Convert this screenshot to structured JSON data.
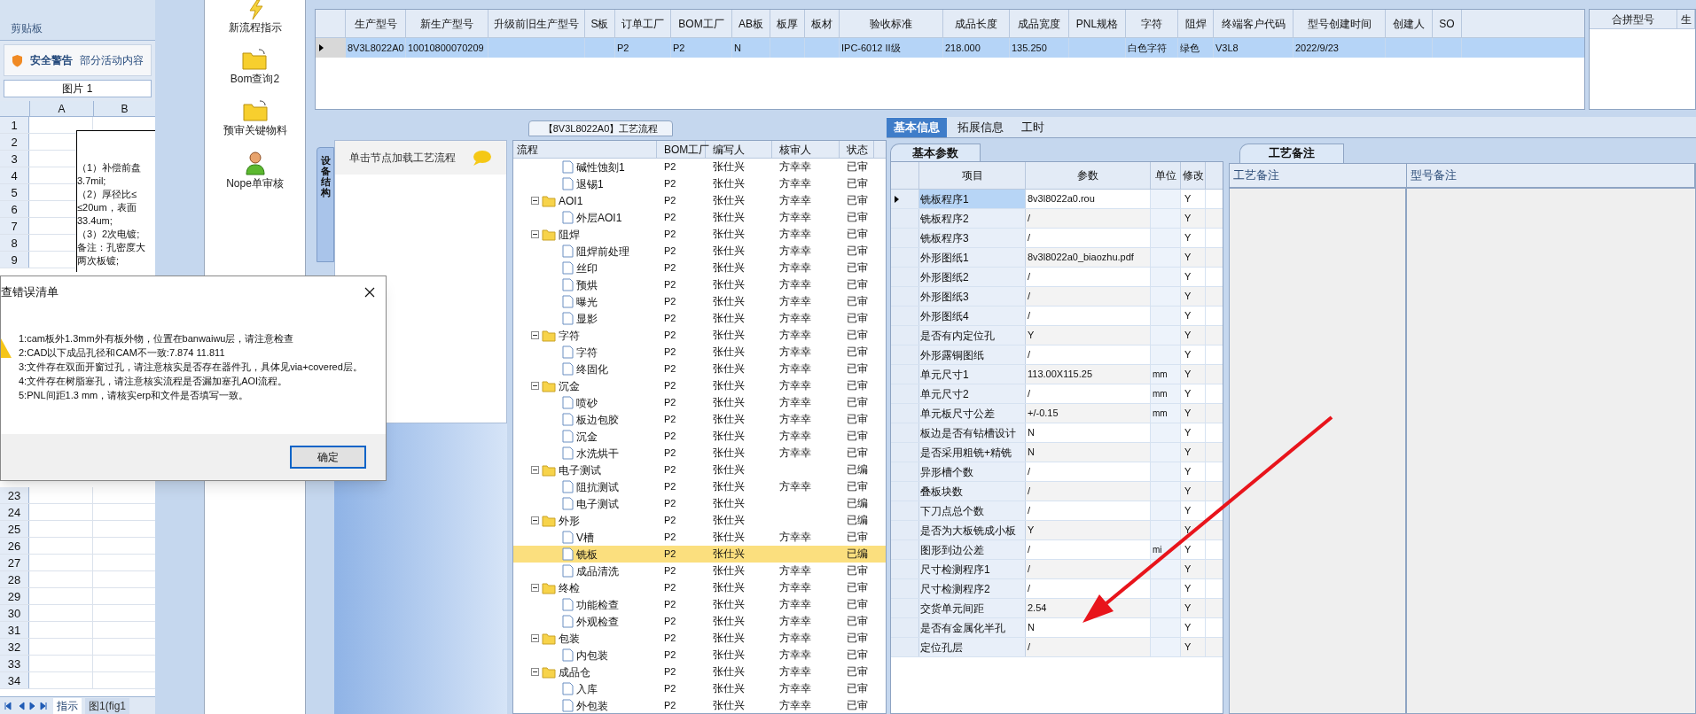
{
  "excel": {
    "ribbon_group": "剪贴板",
    "security_warning": {
      "title": "安全警告",
      "message": "部分活动内容"
    },
    "name_box": "图片 1",
    "columns": [
      "A",
      "B"
    ],
    "rows": [
      "1",
      "2",
      "3",
      "4",
      "5",
      "6",
      "7",
      "8",
      "9",
      "23",
      "24",
      "25",
      "26",
      "27",
      "28",
      "29",
      "30",
      "31",
      "32",
      "33",
      "34"
    ],
    "cell_lines": [
      "（1）补偿前盘",
      "3.7mil;",
      "（2）厚径比≤",
      "≤20um，表面",
      "33.4um;",
      "（3）2次电镀;",
      "备注：孔密度大",
      "两次板镀;"
    ],
    "sheet_tabs": [
      {
        "label": "指示",
        "selected": true
      },
      {
        "label": "图1(fig1",
        "selected": false
      }
    ]
  },
  "toolbar": [
    {
      "label": "新流程指示",
      "kind": "lightning"
    },
    {
      "label": "Bom查询2",
      "kind": "folder"
    },
    {
      "label": "预审关键物料",
      "kind": "folder"
    },
    {
      "label": "Nope单审核",
      "kind": "person"
    }
  ],
  "product_table": {
    "columns": [
      "生产型号",
      "新生产型号",
      "升级前旧生产型号",
      "S板",
      "订单工厂",
      "BOM工厂",
      "AB板",
      "板厚",
      "板材",
      "验收标准",
      "成品长度",
      "成品宽度",
      "PNL规格",
      "字符",
      "阻焊",
      "终端客户代码",
      "型号创建时间",
      "创建人",
      "SO"
    ],
    "rows": [
      {
        "selected": true,
        "cells": [
          "8V3L8022A0",
          "10010800070209",
          null,
          null,
          "P2",
          "P2",
          "N",
          null,
          null,
          "IPC-6012 II级",
          "218.000",
          "135.250",
          null,
          "白色字符",
          "绿色",
          "V3L8",
          "2022/9/23",
          null,
          null
        ]
      }
    ]
  },
  "merge_panel": {
    "columns": [
      "合拼型号",
      "生"
    ]
  },
  "process": {
    "title": "【8V3L8022A0】工艺流程",
    "side_tab": "设备结构",
    "hint": "单击节点加载工艺流程",
    "columns": [
      "流程",
      "BOM工厂",
      "编写人",
      "核审人",
      "状态"
    ],
    "rows": [
      {
        "kind": "file",
        "name": "碱性蚀刻1",
        "bom": "P2",
        "writer": "张仕兴",
        "reviewer": "方幸幸",
        "status": "已审",
        "selected": false
      },
      {
        "kind": "file",
        "name": "退锡1",
        "bom": "P2",
        "writer": "张仕兴",
        "reviewer": "方幸幸",
        "status": "已审",
        "selected": false
      },
      {
        "kind": "folder",
        "name": "AOI1",
        "bom": "P2",
        "writer": "张仕兴",
        "reviewer": "方幸幸",
        "status": "已审",
        "selected": false,
        "children": [
          {
            "kind": "file",
            "name": "外层AOI1",
            "bom": "P2",
            "writer": "张仕兴",
            "reviewer": "方幸幸",
            "status": "已审",
            "selected": false
          }
        ]
      },
      {
        "kind": "folder",
        "name": "阻焊",
        "bom": "P2",
        "writer": "张仕兴",
        "reviewer": "方幸幸",
        "status": "已审",
        "selected": false,
        "children": [
          {
            "kind": "file",
            "name": "阻焊前处理",
            "bom": "P2",
            "writer": "张仕兴",
            "reviewer": "方幸幸",
            "status": "已审",
            "selected": false
          },
          {
            "kind": "file",
            "name": "丝印",
            "bom": "P2",
            "writer": "张仕兴",
            "reviewer": "方幸幸",
            "status": "已审",
            "selected": false
          },
          {
            "kind": "file",
            "name": "预烘",
            "bom": "P2",
            "writer": "张仕兴",
            "reviewer": "方幸幸",
            "status": "已审",
            "selected": false
          },
          {
            "kind": "file",
            "name": "曝光",
            "bom": "P2",
            "writer": "张仕兴",
            "reviewer": "方幸幸",
            "status": "已审",
            "selected": false
          },
          {
            "kind": "file",
            "name": "显影",
            "bom": "P2",
            "writer": "张仕兴",
            "reviewer": "方幸幸",
            "status": "已审",
            "selected": false
          }
        ]
      },
      {
        "kind": "folder",
        "name": "字符",
        "bom": "P2",
        "writer": "张仕兴",
        "reviewer": "方幸幸",
        "status": "已审",
        "selected": false,
        "children": [
          {
            "kind": "file",
            "name": "字符",
            "bom": "P2",
            "writer": "张仕兴",
            "reviewer": "方幸幸",
            "status": "已审",
            "selected": false
          },
          {
            "kind": "file",
            "name": "终固化",
            "bom": "P2",
            "writer": "张仕兴",
            "reviewer": "方幸幸",
            "status": "已审",
            "selected": false
          }
        ]
      },
      {
        "kind": "folder",
        "name": "沉金",
        "bom": "P2",
        "writer": "张仕兴",
        "reviewer": "方幸幸",
        "status": "已审",
        "selected": false,
        "children": [
          {
            "kind": "file",
            "name": "喷砂",
            "bom": "P2",
            "writer": "张仕兴",
            "reviewer": "方幸幸",
            "status": "已审",
            "selected": false
          },
          {
            "kind": "file",
            "name": "板边包胶",
            "bom": "P2",
            "writer": "张仕兴",
            "reviewer": "方幸幸",
            "status": "已审",
            "selected": false
          },
          {
            "kind": "file",
            "name": "沉金",
            "bom": "P2",
            "writer": "张仕兴",
            "reviewer": "方幸幸",
            "status": "已审",
            "selected": false
          },
          {
            "kind": "file",
            "name": "水洗烘干",
            "bom": "P2",
            "writer": "张仕兴",
            "reviewer": "方幸幸",
            "status": "已审",
            "selected": false
          }
        ]
      },
      {
        "kind": "folder",
        "name": "电子测试",
        "bom": "P2",
        "writer": "张仕兴",
        "status": "已编",
        "selected": false,
        "children": [
          {
            "kind": "file",
            "name": "阻抗测试",
            "bom": "P2",
            "writer": "张仕兴",
            "reviewer": "方幸幸",
            "status": "已审",
            "selected": false
          },
          {
            "kind": "file",
            "name": "电子测试",
            "bom": "P2",
            "writer": "张仕兴",
            "status": "已编",
            "selected": false
          }
        ]
      },
      {
        "kind": "folder",
        "name": "外形",
        "bom": "P2",
        "writer": "张仕兴",
        "status": "已编",
        "selected": false,
        "children": [
          {
            "kind": "file",
            "name": "V槽",
            "bom": "P2",
            "writer": "张仕兴",
            "reviewer": "方幸幸",
            "status": "已审",
            "selected": false
          },
          {
            "kind": "file",
            "name": "铣板",
            "bom": "P2",
            "writer": "张仕兴",
            "status": "已编",
            "selected": true
          },
          {
            "kind": "file",
            "name": "成品清洗",
            "bom": "P2",
            "writer": "张仕兴",
            "reviewer": "方幸幸",
            "status": "已审",
            "selected": false
          }
        ]
      },
      {
        "kind": "folder",
        "name": "终检",
        "bom": "P2",
        "writer": "张仕兴",
        "reviewer": "方幸幸",
        "status": "已审",
        "selected": false,
        "children": [
          {
            "kind": "file",
            "name": "功能检查",
            "bom": "P2",
            "writer": "张仕兴",
            "reviewer": "方幸幸",
            "status": "已审",
            "selected": false
          },
          {
            "kind": "file",
            "name": "外观检查",
            "bom": "P2",
            "writer": "张仕兴",
            "reviewer": "方幸幸",
            "status": "已审",
            "selected": false
          }
        ]
      },
      {
        "kind": "folder",
        "name": "包装",
        "bom": "P2",
        "writer": "张仕兴",
        "reviewer": "方幸幸",
        "status": "已审",
        "selected": false,
        "children": [
          {
            "kind": "file",
            "name": "内包装",
            "bom": "P2",
            "writer": "张仕兴",
            "reviewer": "方幸幸",
            "status": "已审",
            "selected": false
          }
        ]
      },
      {
        "kind": "folder",
        "name": "成品仓",
        "bom": "P2",
        "writer": "张仕兴",
        "reviewer": "方幸幸",
        "status": "已审",
        "selected": false,
        "children": [
          {
            "kind": "file",
            "name": "入库",
            "bom": "P2",
            "writer": "张仕兴",
            "reviewer": "方幸幸",
            "status": "已审",
            "selected": false
          },
          {
            "kind": "file",
            "name": "外包装",
            "bom": "P2",
            "writer": "张仕兴",
            "reviewer": "方幸幸",
            "status": "已审",
            "selected": false
          }
        ]
      }
    ]
  },
  "detail_tabs": [
    {
      "label": "基本信息",
      "selected": true
    },
    {
      "label": "拓展信息",
      "selected": false
    },
    {
      "label": "工时",
      "selected": false
    }
  ],
  "params": {
    "tab": "基本参数",
    "columns": [
      "项目",
      "参数",
      "单位",
      "修改"
    ],
    "rows": [
      {
        "item": "铣板程序1",
        "value": "8v3l8022a0.rou",
        "modify": "Y",
        "selected": true
      },
      {
        "item": "铣板程序2",
        "value": "/",
        "modify": "Y",
        "selected": false
      },
      {
        "item": "铣板程序3",
        "value": "/",
        "modify": "Y",
        "selected": false
      },
      {
        "item": "外形图纸1",
        "value": "8v3l8022a0_biaozhu.pdf",
        "modify": "Y",
        "selected": false
      },
      {
        "item": "外形图纸2",
        "value": "/",
        "modify": "Y",
        "selected": false
      },
      {
        "item": "外形图纸3",
        "value": "/",
        "modify": "Y",
        "selected": false
      },
      {
        "item": "外形图纸4",
        "value": "/",
        "modify": "Y",
        "selected": false
      },
      {
        "item": "是否有内定位孔",
        "value": "Y",
        "modify": "Y",
        "selected": false
      },
      {
        "item": "外形露铜图纸",
        "value": "/",
        "modify": "Y",
        "selected": false
      },
      {
        "item": "单元尺寸1",
        "value": "113.00X115.25",
        "unit": "mm",
        "modify": "Y",
        "selected": false
      },
      {
        "item": "单元尺寸2",
        "value": "/",
        "unit": "mm",
        "modify": "Y",
        "selected": false
      },
      {
        "item": "单元板尺寸公差",
        "value": "+/-0.15",
        "unit": "mm",
        "modify": "Y",
        "selected": false
      },
      {
        "item": "板边是否有钻槽设计",
        "value": "N",
        "modify": "Y",
        "selected": false
      },
      {
        "item": "是否采用粗铣+精铣",
        "value": "N",
        "modify": "Y",
        "selected": false
      },
      {
        "item": "异形槽个数",
        "value": "/",
        "modify": "Y",
        "selected": false
      },
      {
        "item": "叠板块数",
        "value": "/",
        "modify": "Y",
        "selected": false
      },
      {
        "item": "下刀点总个数",
        "value": "/",
        "modify": "Y",
        "selected": false
      },
      {
        "item": "是否为大板铣成小板",
        "value": "Y",
        "modify": "Y",
        "selected": false
      },
      {
        "item": "图形到边公差",
        "value": "/",
        "unit": "mi",
        "modify": "Y",
        "selected": false
      },
      {
        "item": "尺寸检测程序1",
        "value": "/",
        "modify": "Y",
        "selected": false
      },
      {
        "item": "尺寸检测程序2",
        "value": "/",
        "modify": "Y",
        "selected": false
      },
      {
        "item": "交货单元间距",
        "value": "2.54",
        "modify": "Y",
        "selected": false
      },
      {
        "item": "是否有金属化半孔",
        "value": "N",
        "modify": "Y",
        "selected": false
      },
      {
        "item": "定位孔层",
        "value": "/",
        "modify": "Y",
        "selected": false
      }
    ]
  },
  "remarks": {
    "tab": "工艺备注",
    "columns": [
      "工艺备注",
      "型号备注"
    ]
  },
  "dialog": {
    "title": "查错误清单",
    "messages": [
      "1:cam板外1.3mm外有板外物，位置在banwaiwu层，请注意检查",
      "2:CAD以下成品孔径和CAM不一致:7.874 11.811",
      "3:文件存在双面开窗过孔，请注意核实是否存在器件孔，具体见via+covered层。",
      "4:文件存在树脂塞孔，请注意核实流程是否漏加塞孔AOI流程。",
      "5:PNL间距1.3 mm，请核实erp和文件是否填写一致。"
    ],
    "button": "确定"
  }
}
